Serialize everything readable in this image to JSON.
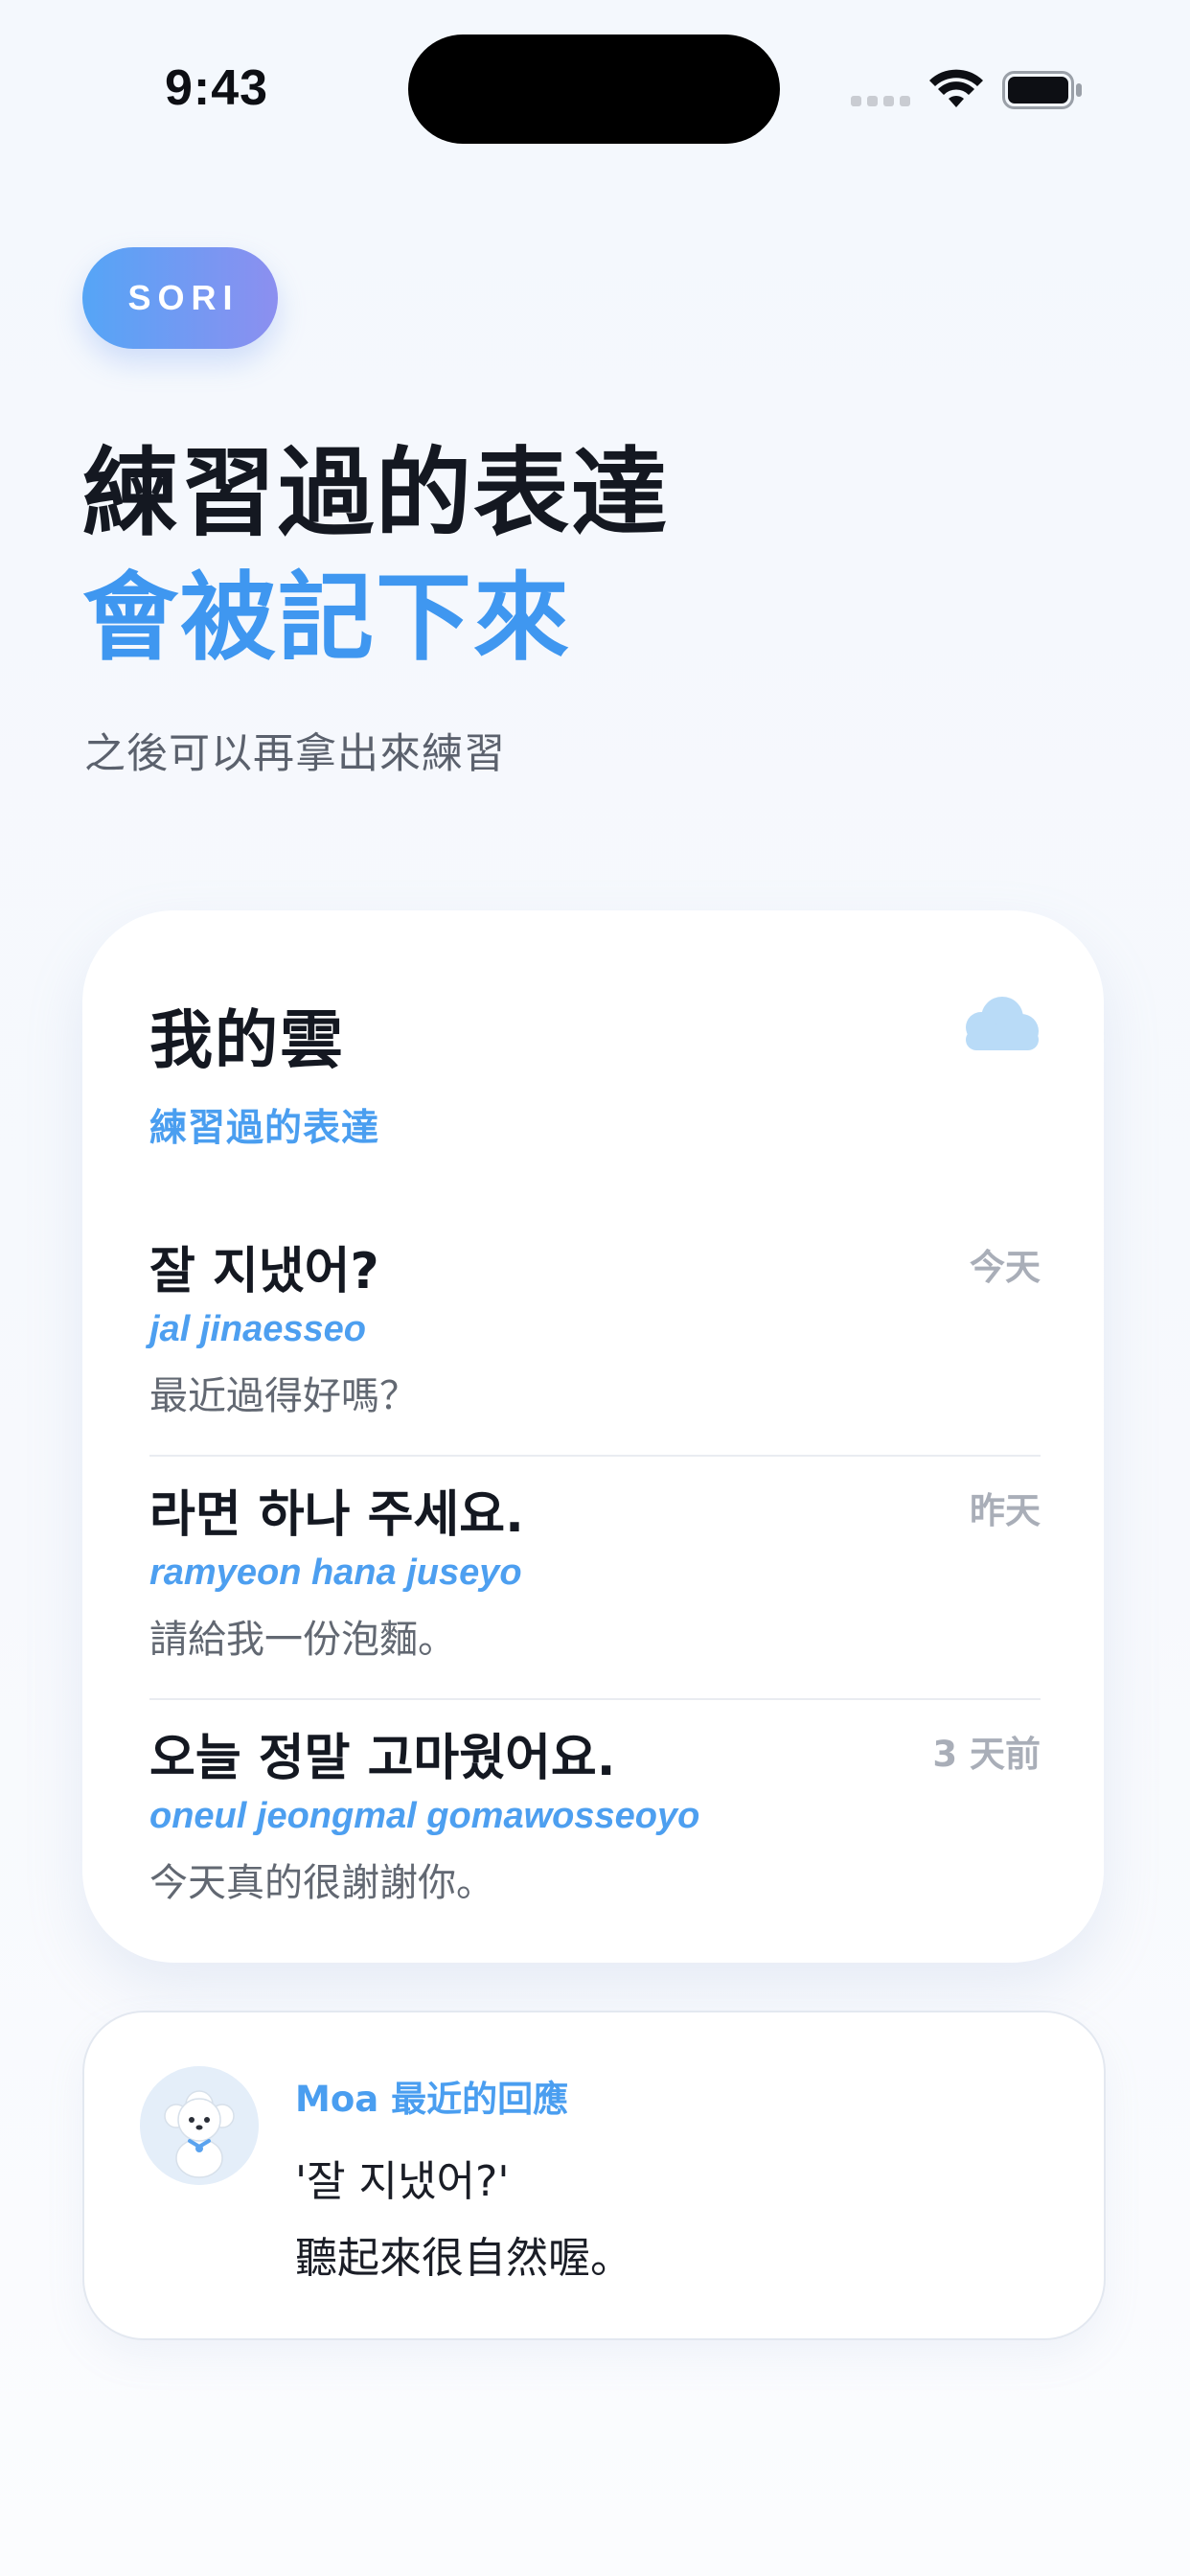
{
  "status_bar": {
    "time": "9:43"
  },
  "badge": {
    "label": "SORI"
  },
  "hero": {
    "line1": "練習過的表達",
    "line2": "會被記下來",
    "subtitle": "之後可以再拿出來練習"
  },
  "card": {
    "title": "我的雲",
    "subtitle": "練習過的表達",
    "icon": "cloud-icon",
    "entries": [
      {
        "korean": "잘 지냈어?",
        "romanization": "jal jinaesseo",
        "chinese": "最近過得好嗎？",
        "when": "今天"
      },
      {
        "korean": "라면 하나 주세요.",
        "romanization": "ramyeon hana juseyo",
        "chinese": "請給我一份泡麵。",
        "when": "昨天"
      },
      {
        "korean": "오늘 정말 고마웠어요.",
        "romanization": "oneul jeongmal gomawosseoyo",
        "chinese": "今天真的很謝謝你。",
        "when": "3 天前"
      }
    ]
  },
  "reply": {
    "label": "Moa 最近的回應",
    "line1": "'잘 지냈어?'",
    "line2": "聽起來很自然喔。"
  },
  "colors": {
    "accent": "#3f97f0",
    "badge_gradient_start": "#55a5f6",
    "badge_gradient_end": "#8c8ff0",
    "muted": "#a9aeb8"
  }
}
